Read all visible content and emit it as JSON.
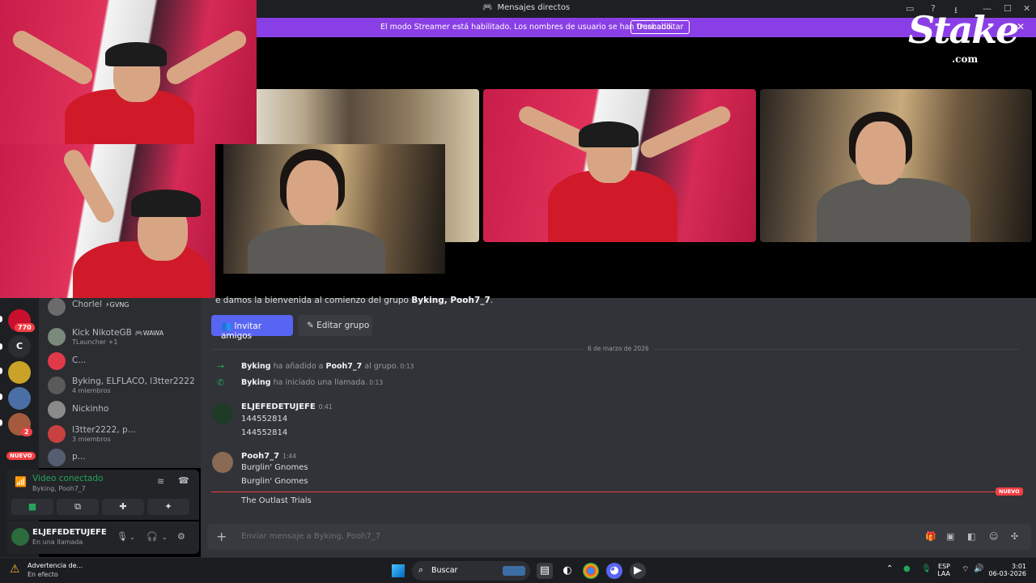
{
  "window": {
    "title": "Mensajes directos",
    "controls": [
      "—",
      "☐",
      "✕"
    ]
  },
  "streamer_banner": {
    "message": "El modo Streamer está habilitado. Los nombres de usuario se han truncado.",
    "button": "Deshabilitar"
  },
  "overlay_logo": {
    "big": "Stake",
    "small": ".com"
  },
  "welcome": {
    "prefix": "e damos la bienvenida al comienzo del grupo ",
    "group": "Byking, Pooh7_7",
    "suffix": "."
  },
  "buttons": {
    "invite": "Invitar amigos",
    "edit": "Editar grupo"
  },
  "date_separator": "6 de marzo de 2026",
  "system_messages": [
    {
      "actor": "Byking",
      "action": " ha añadido a ",
      "target": "Pooh7_7",
      "rest": " al grupo.",
      "time": "0:13"
    },
    {
      "actor": "Byking",
      "action": " ha iniciado una llamada.",
      "target": "",
      "rest": "",
      "time": "0:13"
    }
  ],
  "messages": [
    {
      "author": "ELJEFEDETUJEFE",
      "time": "0:41",
      "lines": [
        "144552814",
        "144552814"
      ]
    },
    {
      "author": "Pooh7_7",
      "time": "1:44",
      "lines": [
        "Burglin' Gnomes",
        "Burglin' Gnomes"
      ]
    },
    {
      "author": "",
      "time": "",
      "lines": [
        "The Outlast Trials"
      ]
    }
  ],
  "new_marker": "NUEVO",
  "composer": {
    "placeholder": "Enviar mensaje a Byking, Pooh7_7"
  },
  "server_rail": {
    "badge_770": "770",
    "letter": "C",
    "badge_2": "2",
    "nuevo": "NUEVO"
  },
  "dm_list": [
    {
      "name": "Chorlel",
      "tag": "⚡GVNG",
      "sub": ""
    },
    {
      "name": "Kick NikoteGB",
      "tag": "🎮WAWA",
      "sub": "TLauncher +1"
    },
    {
      "name": "C...",
      "tag": "",
      "sub": ""
    },
    {
      "name": "Byking, ELFLACO, l3tter2222",
      "tag": "",
      "sub": "4 miembros"
    },
    {
      "name": "Nickinho",
      "tag": "",
      "sub": ""
    },
    {
      "name": "l3tter2222, p...",
      "tag": "",
      "sub": "3 miembros"
    },
    {
      "name": "p...",
      "tag": "",
      "sub": ""
    }
  ],
  "voice": {
    "state": "Video conectado",
    "channel": "Byking, Pooh7_7"
  },
  "user": {
    "name": "ELJEFEDETUJEFE",
    "status": "En una llamada"
  },
  "taskbar": {
    "notif_title": "Advertencia de...",
    "notif_sub": "En efecto",
    "search": "Buscar",
    "lang": "ESP",
    "lang2": "LAA",
    "time": "3:01",
    "date": "06-03-2026"
  },
  "colors": {
    "accent": "#5865f2",
    "streamer": "#8a3fe6",
    "danger": "#f23f43",
    "online": "#23a55a"
  }
}
